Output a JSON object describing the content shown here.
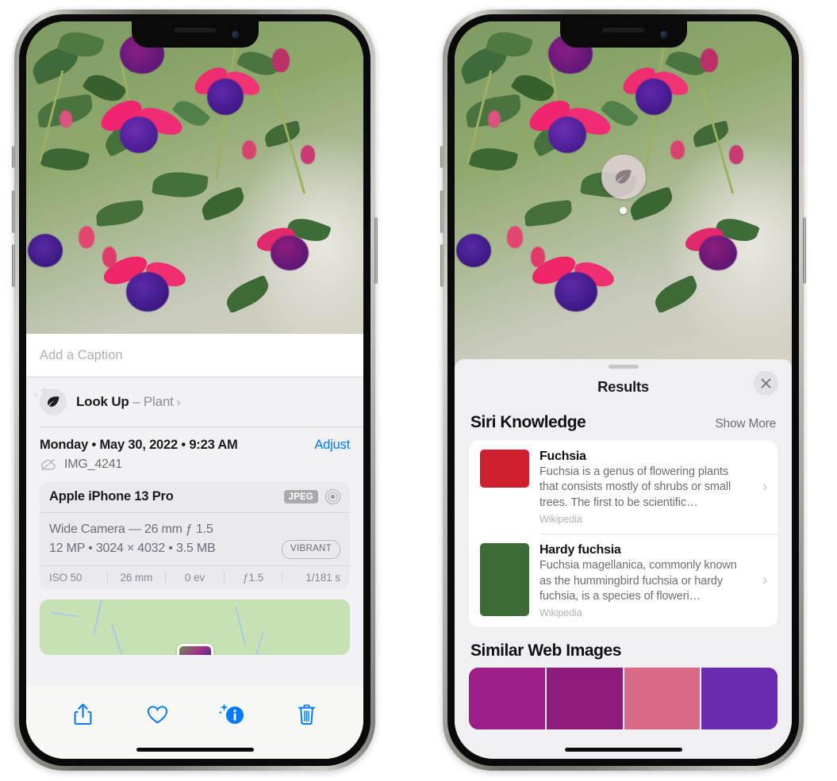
{
  "left_phone": {
    "name": "photos-detail-screen",
    "photo": {
      "alt": "fuchsia-flowers-hanging-basket"
    },
    "caption": {
      "placeholder": "Add a Caption",
      "value": ""
    },
    "lookup": {
      "icon": "leaf-icon",
      "label_bold": "Look Up",
      "separator": " – ",
      "label_plain": "Plant",
      "chevron": "›"
    },
    "date_row": {
      "date_text": "Monday • May 30, 2022 • 9:23 AM",
      "adjust_label": "Adjust"
    },
    "file_row": {
      "icon": "icloud-slash-icon",
      "filename": "IMG_4241"
    },
    "camera_card": {
      "model": "Apple iPhone 13 Pro",
      "format_badge": "JPEG",
      "aperture_icon": "lens-icon",
      "lens_line": "Wide Camera — 26 mm ƒ 1.5",
      "specs_line": "12 MP • 3024 × 4032 • 3.5 MB",
      "style_badge": "VIBRANT",
      "exif": [
        "ISO 50",
        "26 mm",
        "0 ev",
        "ƒ1.5",
        "1/181 s"
      ]
    },
    "map": {
      "pin_label": "photo-location-pin"
    },
    "toolbar": {
      "share_icon": "share-icon",
      "favorite_icon": "heart-icon",
      "info_icon": "info-sparkle-icon",
      "delete_icon": "trash-icon"
    },
    "accent_color": "#047aff"
  },
  "right_phone": {
    "name": "visual-lookup-results-screen",
    "leaf_badge": {
      "icon": "leaf-icon"
    },
    "results": {
      "title": "Results",
      "close_icon": "close-icon",
      "siri_knowledge": {
        "section_title": "Siri Knowledge",
        "show_more": "Show More",
        "items": [
          {
            "title": "Fuchsia",
            "description": "Fuchsia is a genus of flowering plants that consists mostly of shrubs or small trees. The first to be scientific…",
            "source": "Wikipedia",
            "thumb": "fuchsia-thumbnail",
            "chevron": "›"
          },
          {
            "title": "Hardy fuchsia",
            "description": "Fuchsia magellanica, commonly known as the hummingbird fuchsia or hardy fuchsia, is a species of floweri…",
            "source": "Wikipedia",
            "thumb": "hardy-fuchsia-thumbnail",
            "chevron": "›"
          }
        ]
      },
      "similar_web_images": {
        "section_title": "Similar Web Images",
        "thumbs": [
          "similar-image-1",
          "similar-image-2",
          "similar-image-3",
          "similar-image-4"
        ]
      }
    }
  }
}
